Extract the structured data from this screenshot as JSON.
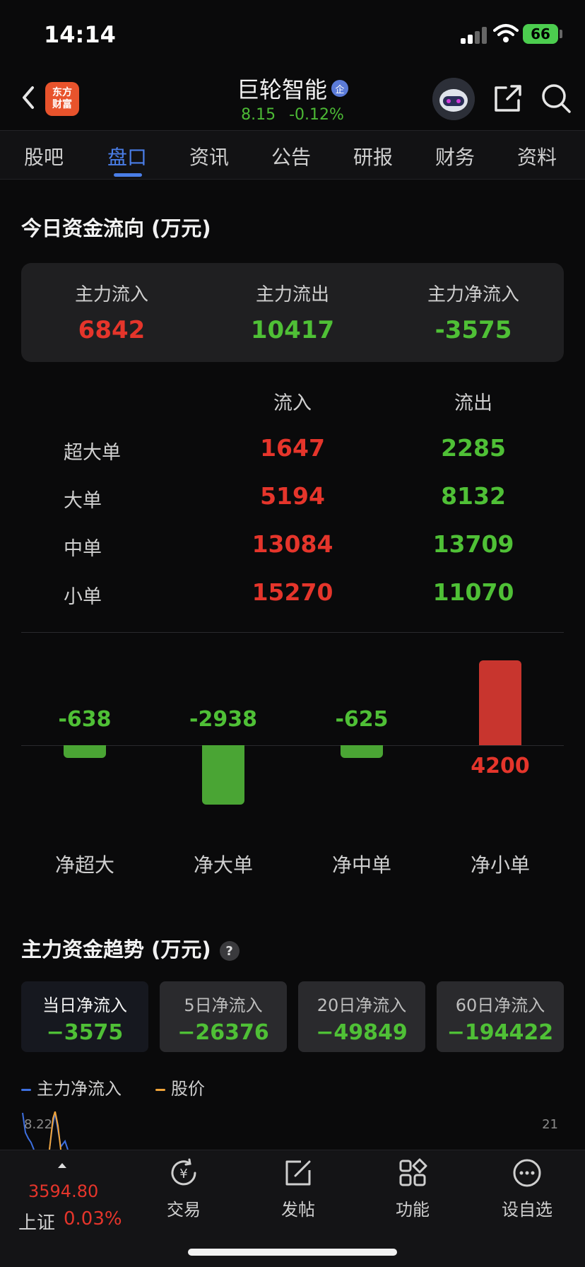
{
  "status": {
    "time": "14:14",
    "battery": "66"
  },
  "header": {
    "logo_line1": "东方",
    "logo_line2": "财富",
    "stock_name": "巨轮智能",
    "badge": "企",
    "price": "8.15",
    "change": "-0.12%"
  },
  "tabs": [
    {
      "label": "股吧"
    },
    {
      "label": "盘口",
      "active": true
    },
    {
      "label": "资讯"
    },
    {
      "label": "公告"
    },
    {
      "label": "研报"
    },
    {
      "label": "财务"
    },
    {
      "label": "资料"
    }
  ],
  "flow": {
    "title": "今日资金流向 (万元)",
    "summary": [
      {
        "label": "主力流入",
        "value": "6842",
        "color": "red"
      },
      {
        "label": "主力流出",
        "value": "10417",
        "color": "green"
      },
      {
        "label": "主力净流入",
        "value": "-3575",
        "color": "green"
      }
    ],
    "col_in": "流入",
    "col_out": "流出",
    "rows": [
      {
        "label": "超大单",
        "in": "1647",
        "out": "2285"
      },
      {
        "label": "大单",
        "in": "5194",
        "out": "8132"
      },
      {
        "label": "中单",
        "in": "13084",
        "out": "13709"
      },
      {
        "label": "小单",
        "in": "15270",
        "out": "11070"
      }
    ]
  },
  "chart_data": {
    "type": "bar",
    "categories": [
      "净超大",
      "净大单",
      "净中单",
      "净小单"
    ],
    "values": [
      -638,
      -2938,
      -625,
      4200
    ],
    "data_labels": [
      "-638",
      "-2938",
      "-625",
      "4200"
    ],
    "colors": {
      "positive": "#c8352e",
      "negative": "#4aa534"
    }
  },
  "trend": {
    "title": "主力资金趋势 (万元)",
    "help": "?",
    "cards": [
      {
        "label": "当日净流入",
        "value": "−3575",
        "active": true
      },
      {
        "label": "5日净流入",
        "value": "−26376"
      },
      {
        "label": "20日净流入",
        "value": "−49849"
      },
      {
        "label": "60日净流入",
        "value": "−194422"
      }
    ],
    "legend": [
      {
        "label": "主力净流入",
        "color": "#3d6fe0"
      },
      {
        "label": "股价",
        "color": "#f0a43a"
      }
    ],
    "axis_left": "8.22",
    "axis_right": "21"
  },
  "bottom": {
    "index_value": "3594.80",
    "index_name": "上证",
    "index_change": "0.03%",
    "nav": [
      {
        "label": "交易",
        "icon": "trade-icon"
      },
      {
        "label": "发帖",
        "icon": "post-icon"
      },
      {
        "label": "功能",
        "icon": "functions-icon"
      },
      {
        "label": "设自选",
        "icon": "more-icon"
      }
    ]
  }
}
